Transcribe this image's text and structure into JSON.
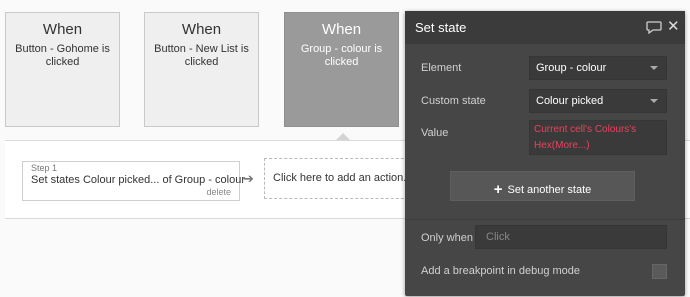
{
  "events": [
    {
      "when": "When",
      "description": "Button - Gohome is clicked"
    },
    {
      "when": "When",
      "description": "Button - New List is clicked"
    },
    {
      "when": "When",
      "description": "Group - colour is clicked"
    }
  ],
  "workflow": {
    "step_label": "Step 1",
    "step_title": "Set states Colour picked... of Group - colour",
    "step_delete": "delete",
    "arrow": "➔",
    "add_action": "Click here to add an action..."
  },
  "panel": {
    "title": "Set state",
    "element_label": "Element",
    "element_value": "Group - colour",
    "custom_state_label": "Custom state",
    "custom_state_value": "Colour picked",
    "value_label": "Value",
    "value_expression": "Current cell's Colours's Hex(More...)",
    "set_another_plus": "+",
    "set_another_label": "Set another state",
    "only_when_label": "Only when",
    "only_when_placeholder": "Click",
    "breakpoint_label": "Add a breakpoint in debug mode"
  },
  "colors": {
    "panel_bg": "#464646",
    "expression_red": "#e8435c",
    "selected_event": "#9a9a9a"
  },
  "icons": {
    "comment": "comment-icon",
    "close": "close-icon",
    "dropdown": "chevron-down-icon"
  }
}
